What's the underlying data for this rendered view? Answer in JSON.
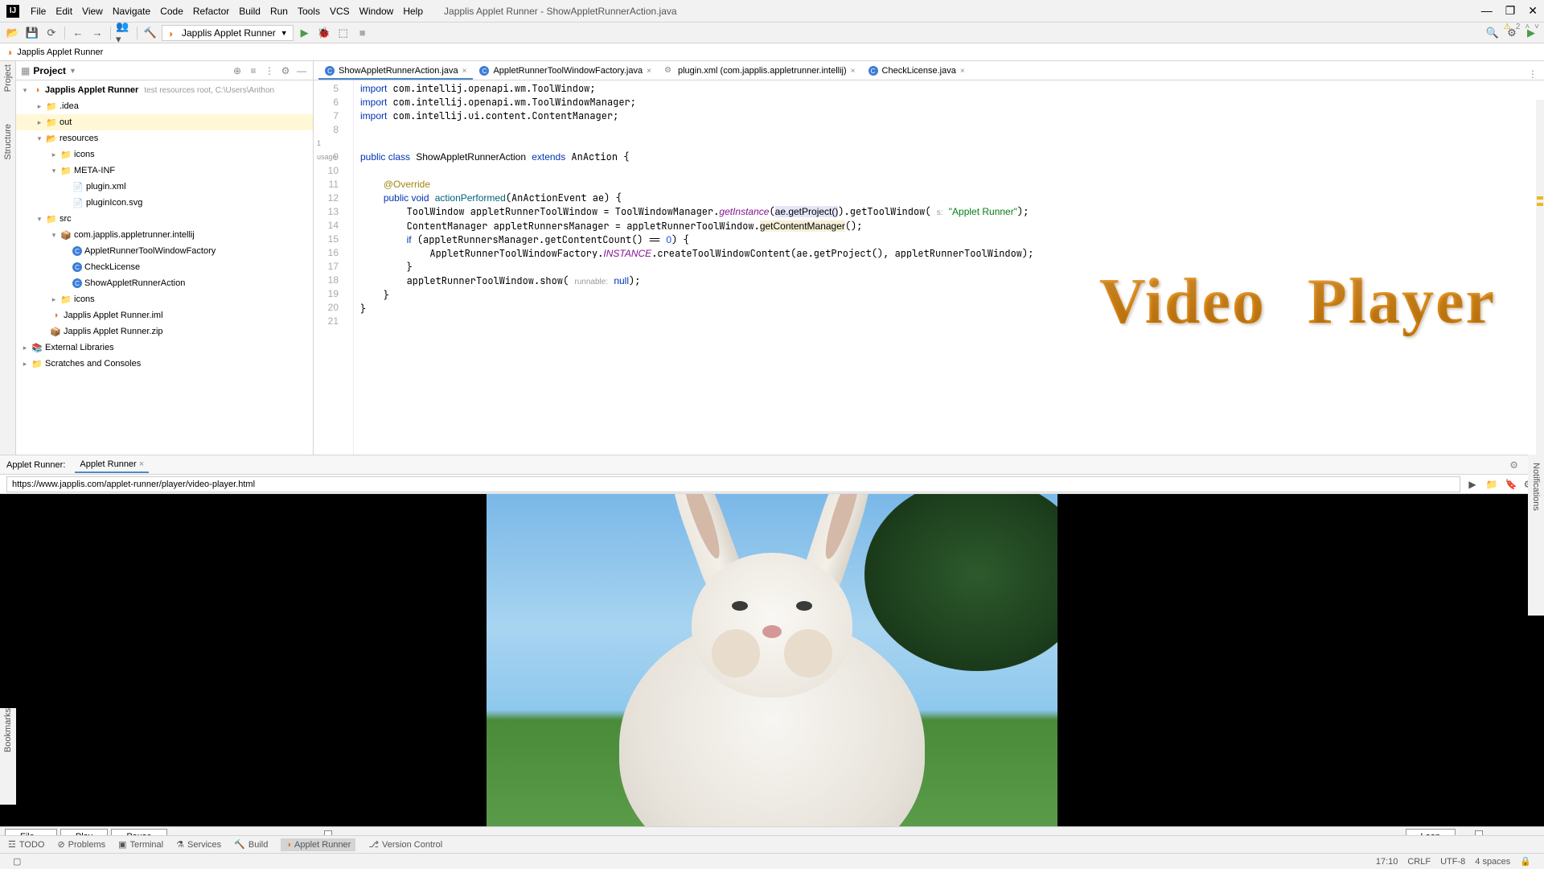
{
  "window": {
    "title": "Japplis Applet Runner - ShowAppletRunnerAction.java"
  },
  "menubar": [
    "File",
    "Edit",
    "View",
    "Navigate",
    "Code",
    "Refactor",
    "Build",
    "Run",
    "Tools",
    "VCS",
    "Window",
    "Help"
  ],
  "toolbar": {
    "run_config": "Japplis Applet Runner"
  },
  "breadcrumb": {
    "project": "Japplis Applet Runner"
  },
  "project_panel": {
    "title": "Project",
    "root": "Japplis Applet Runner",
    "root_sub": "test resources root,  C:\\Users\\Anthon",
    "nodes": {
      "idea": ".idea",
      "out": "out",
      "resources": "resources",
      "icons": "icons",
      "metainf": "META-INF",
      "pluginxml": "plugin.xml",
      "pluginicon": "pluginIcon.svg",
      "src": "src",
      "package": "com.japplis.appletrunner.intellij",
      "factory": "AppletRunnerToolWindowFactory",
      "checklicense": "CheckLicense",
      "showaction": "ShowAppletRunnerAction",
      "icons2": "icons",
      "iml": "Japplis Applet Runner.iml",
      "zip": "Japplis Applet Runner.zip",
      "extlib": "External Libraries",
      "scratches": "Scratches and Consoles"
    }
  },
  "editor_tabs": {
    "t1": "ShowAppletRunnerAction.java",
    "t2": "AppletRunnerToolWindowFactory.java",
    "t3": "plugin.xml (com.japplis.appletrunner.intellij)",
    "t4": "CheckLicense.java"
  },
  "editor": {
    "warning_count": "2",
    "usage_label": "1 usage",
    "line_start": 5
  },
  "watermark_text": "Video Player",
  "applet_panel": {
    "label": "Applet Runner:",
    "tab": "Applet Runner",
    "url": "https://www.japplis.com/applet-runner/player/video-player.html",
    "btn_file": "File...",
    "btn_play": "Play",
    "btn_pause": "Pause",
    "btn_loop": "Loop"
  },
  "tool_tabs": {
    "todo": "TODO",
    "problems": "Problems",
    "terminal": "Terminal",
    "services": "Services",
    "build": "Build",
    "applet": "Applet Runner",
    "vcs": "Version Control"
  },
  "left_tabs": {
    "project": "Project",
    "structure": "Structure",
    "bookmarks": "Bookmarks"
  },
  "right_tabs": {
    "notifications": "Notifications"
  },
  "statusbar": {
    "pos": "17:10",
    "sep": "CRLF",
    "enc": "UTF-8",
    "indent": "4 spaces"
  }
}
